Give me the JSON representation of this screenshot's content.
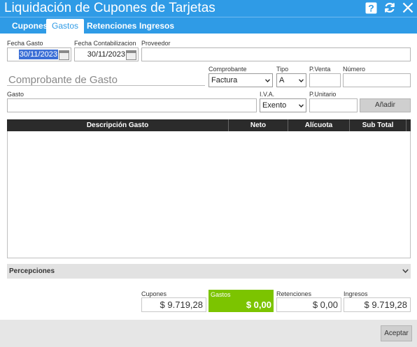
{
  "window": {
    "title": "Liquidación de Cupones de Tarjetas",
    "icons": [
      "help-icon",
      "refresh-icon",
      "close-icon"
    ]
  },
  "tabs": [
    "Cupones",
    "Gastos",
    "Retenciones",
    "Ingresos"
  ],
  "active_tab": "Gastos",
  "form": {
    "fecha_gasto": {
      "label": "Fecha Gasto",
      "value": "30/11/2023"
    },
    "fecha_contabilizacion": {
      "label": "Fecha Contabilizacion",
      "value": "30/11/2023"
    },
    "proveedor": {
      "label": "Proveedor",
      "value": ""
    },
    "comprobante_gasto_placeholder": "Comprobante de Gasto",
    "comprobante": {
      "label": "Comprobante",
      "value": "Factura"
    },
    "tipo": {
      "label": "Tipo",
      "value": "A"
    },
    "p_venta": {
      "label": "P.Venta",
      "value": ""
    },
    "numero": {
      "label": "Número",
      "value": ""
    },
    "gasto": {
      "label": "Gasto",
      "value": ""
    },
    "iva": {
      "label": "I.V.A.",
      "value": "Exento"
    },
    "p_unitario": {
      "label": "P.Unitario",
      "value": ""
    },
    "add_button": "Añadir"
  },
  "table": {
    "columns": [
      "Descripción Gasto",
      "Neto",
      "Alícuota",
      "Sub Total"
    ],
    "rows": []
  },
  "percepciones": {
    "label": "Percepciones"
  },
  "totals": [
    {
      "label": "Cupones",
      "value": "$ 9.719,28",
      "highlight": false
    },
    {
      "label": "Gastos",
      "value": "$ 0,00",
      "highlight": true
    },
    {
      "label": "Retenciones",
      "value": "$ 0,00",
      "highlight": false
    },
    {
      "label": "Ingresos",
      "value": "$ 9.719,28",
      "highlight": false
    }
  ],
  "accept_button": "Aceptar",
  "colors": {
    "header_blue": "#2f9be6",
    "highlight_green": "#7cc400",
    "table_header": "#2b2b2b",
    "selection_blue": "#3b6fd6"
  }
}
